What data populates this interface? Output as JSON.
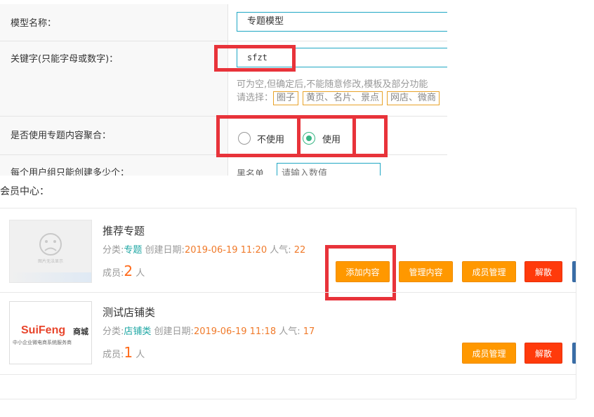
{
  "form": {
    "model_name": {
      "label": "模型名称：",
      "value": "专题模型"
    },
    "keyword": {
      "label": "关键字(只能字母或数字)：",
      "value": "sfzt",
      "hint": "可为空,但确定后,不能随意修改,模板及部分功能",
      "choose_label": "请选择：",
      "choices": [
        "圈子",
        "黄页、名片、景点",
        "网店、微商"
      ]
    },
    "aggregate": {
      "label": "是否使用专题内容聚合：",
      "options": [
        "不使用",
        "使用"
      ],
      "selected": "使用"
    },
    "limit": {
      "label": "每个用户组只能创建多少个：",
      "sub_label": "黑名单",
      "placeholder": "请输入数值"
    }
  },
  "member_center": {
    "header": "会员中心：",
    "groups": [
      {
        "title": "推荐专题",
        "thumb_caption": "图片无法显示",
        "category_label": "分类:",
        "category": "专题",
        "created_label": "创建日期:",
        "created": "2019-06-19 11:20",
        "popularity_label": "人气:",
        "popularity": "22",
        "members_label": "成员:",
        "members": "2",
        "members_unit": "人",
        "buttons": [
          "添加内容",
          "管理内容",
          "成员管理",
          "解散"
        ]
      },
      {
        "title": "测试店铺类",
        "thumb_brand": "SuiFeng",
        "thumb_brand_suffix": "商城",
        "thumb_slogan": "中小企业微电商系统服务商",
        "category_label": "分类:",
        "category": "店铺类",
        "created_label": "创建日期:",
        "created": "2019-06-19 11:18",
        "popularity_label": "人气:",
        "popularity": "17",
        "members_label": "成员:",
        "members": "1",
        "members_unit": "人",
        "buttons": [
          "成员管理",
          "解散"
        ]
      }
    ]
  },
  "colors": {
    "teal": "#1fa7a4",
    "orange_button": "#ff9800",
    "red_button": "#ff3a0b",
    "highlight_red": "#e8333a",
    "radio_green": "#38b584"
  }
}
